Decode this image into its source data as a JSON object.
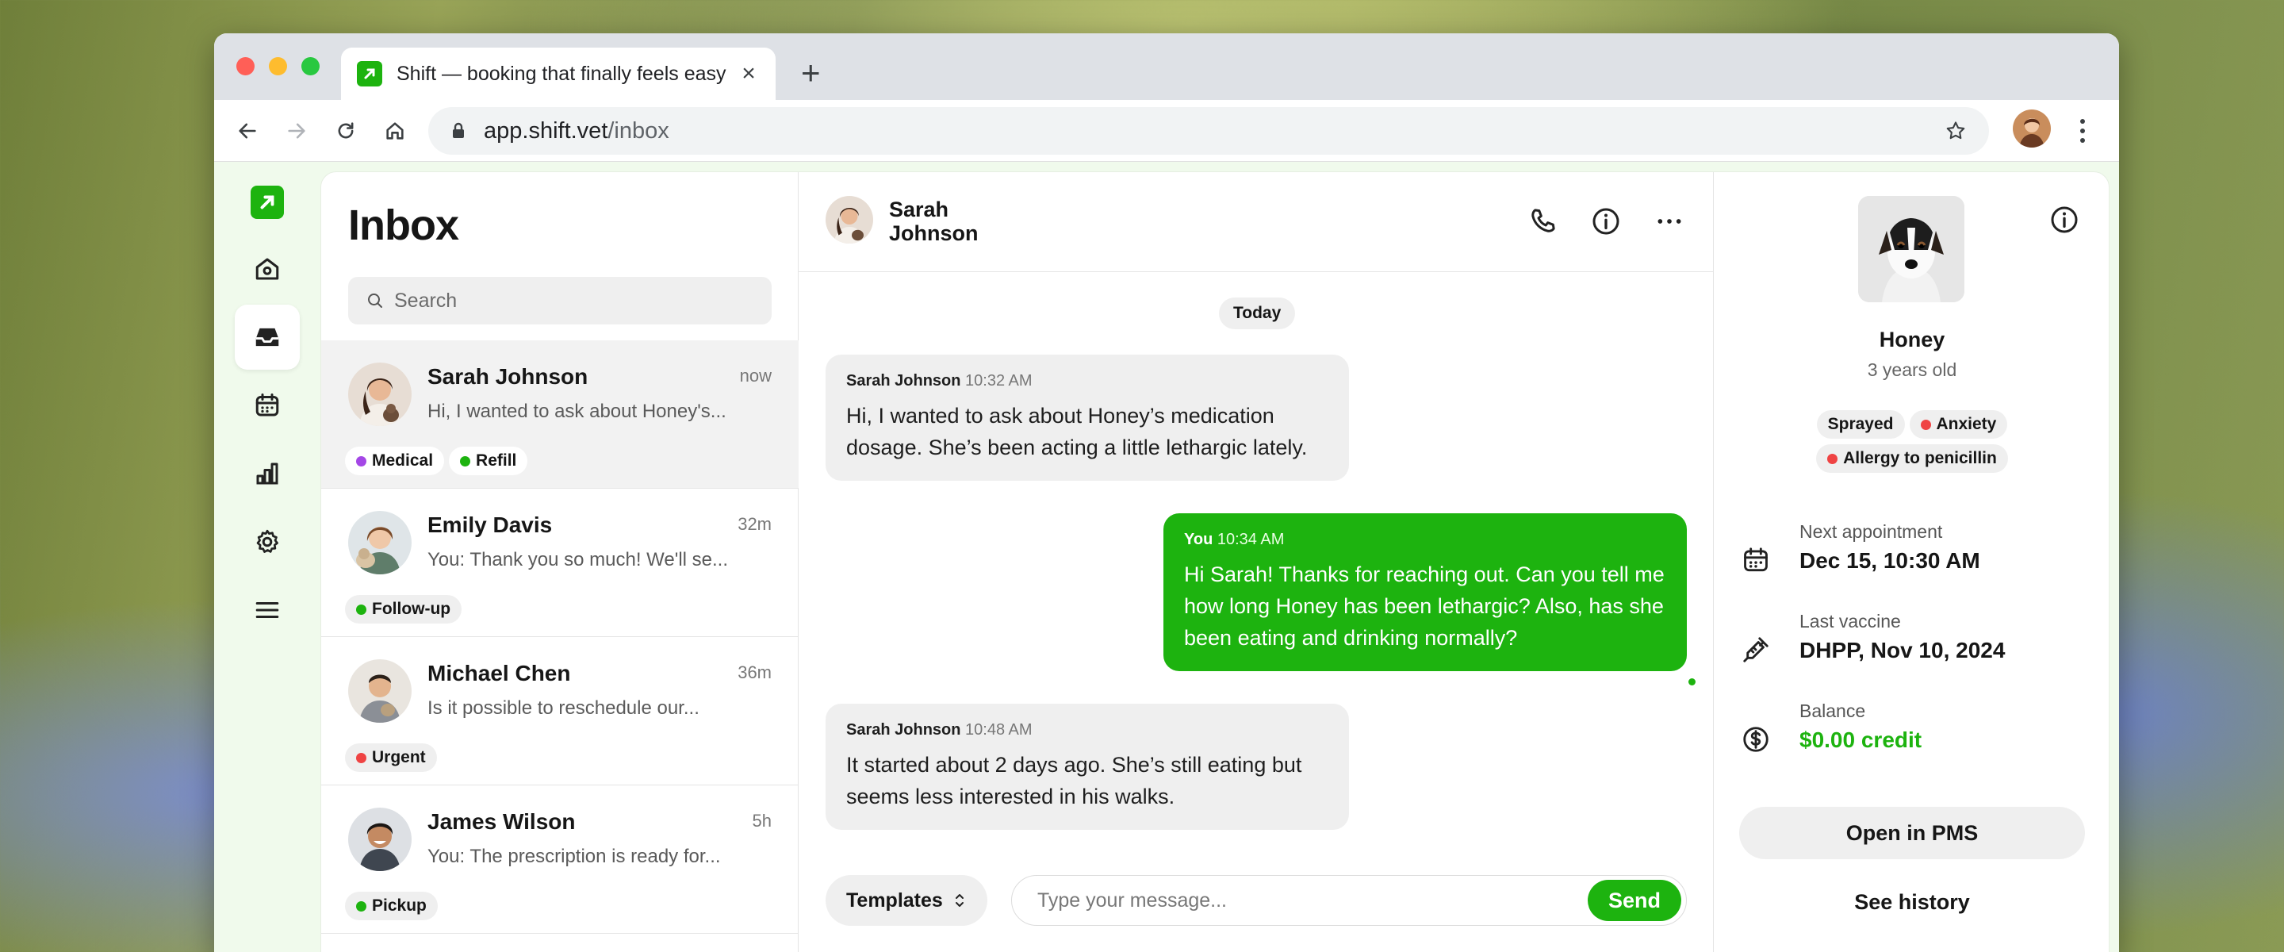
{
  "browser": {
    "tab_title": "Shift — booking that finally feels easy",
    "url_host": "app.shift.vet",
    "url_path": "/inbox"
  },
  "inbox": {
    "title": "Inbox",
    "search_placeholder": "Search",
    "conversations": [
      {
        "name": "Sarah Johnson",
        "preview": "Hi, I wanted to ask about Honey's...",
        "time": "now",
        "tags": [
          {
            "label": "Medical",
            "color": "#a447e6"
          },
          {
            "label": "Refill",
            "color": "#1db30f"
          }
        ]
      },
      {
        "name": "Emily Davis",
        "preview": "You: Thank you so much! We'll se...",
        "time": "32m",
        "tags": [
          {
            "label": "Follow-up",
            "color": "#1db30f"
          }
        ]
      },
      {
        "name": "Michael Chen",
        "preview": "Is it possible to reschedule our...",
        "time": "36m",
        "tags": [
          {
            "label": "Urgent",
            "color": "#ef4343"
          }
        ]
      },
      {
        "name": "James Wilson",
        "preview": "You: The prescription is ready for...",
        "time": "5h",
        "tags": [
          {
            "label": "Pickup",
            "color": "#1db30f"
          }
        ]
      }
    ]
  },
  "chat": {
    "contact_first": "Sarah",
    "contact_last": "Johnson",
    "day_label": "Today",
    "messages": [
      {
        "author": "Sarah Johnson",
        "time": "10:32 AM",
        "dir": "in",
        "text": "Hi, I wanted to ask about Honey’s medication dosage. She’s been acting a little lethargic lately."
      },
      {
        "author": "You",
        "time": "10:34 AM",
        "dir": "out",
        "text": "Hi Sarah! Thanks for reaching out. Can you tell me how long Honey has been lethargic? Also, has she been eating and drinking normally?"
      },
      {
        "author": "Sarah Johnson",
        "time": "10:48 AM",
        "dir": "in",
        "text": "It started about 2 days ago. She’s still eating but seems less interested in his walks."
      }
    ],
    "templates_label": "Templates",
    "compose_placeholder": "Type your message...",
    "send_label": "Send"
  },
  "pet": {
    "name": "Honey",
    "age": "3 years old",
    "tags_row1": [
      {
        "label": "Sprayed",
        "color": ""
      },
      {
        "label": "Anxiety",
        "color": "#ef4343"
      }
    ],
    "tags_row2": [
      {
        "label": "Allergy to penicillin",
        "color": "#ef4343"
      }
    ],
    "next_appt_label": "Next appointment",
    "next_appt_value": "Dec 15, 10:30 AM",
    "vaccine_label": "Last vaccine",
    "vaccine_value": "DHPP, Nov 10, 2024",
    "balance_label": "Balance",
    "balance_value": "$0.00 credit",
    "open_pms_label": "Open in PMS",
    "history_label": "See history"
  },
  "colors": {
    "brand": "#1db30f",
    "danger": "#ef4343",
    "purple": "#a447e6"
  }
}
